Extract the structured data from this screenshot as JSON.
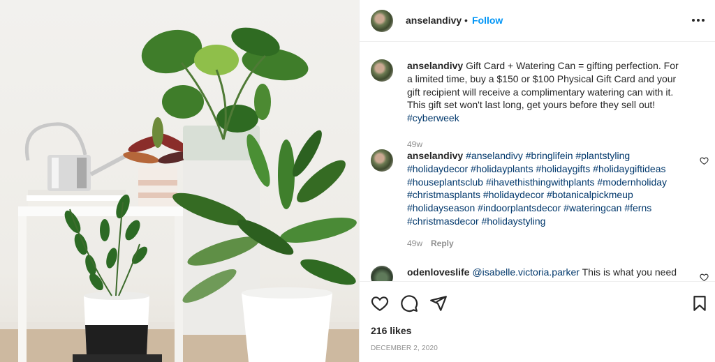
{
  "post": {
    "username": "anselandivy",
    "follow_label": "Follow",
    "separator": "•",
    "more_icon": "more-horizontal-icon"
  },
  "comments": [
    {
      "username": "anselandivy",
      "text": "Gift Card + Watering Can = gifting perfection. For a limited time, buy a $150 or $100 Physical Gift Card and your gift recipient will receive a complimentary watering can with it. This gift set won't last long, get yours before they sell out!",
      "hashtags": "#cyberweek",
      "age": "49w",
      "reply": ""
    },
    {
      "username": "anselandivy",
      "text": "",
      "hashtags": "#anselandivy #bringlifein #plantstyling #holidaydecor #holidayplants #holidaygifts #holidaygiftideas #houseplantsclub #ihavethisthingwithplants #modernholiday #christmasplants #holidaydecor #botanicalpickmeup #holidayseason #indoorplantsdecor #wateringcan #ferns #christmasdecor #holidaystyling",
      "age": "49w",
      "reply": "Reply"
    },
    {
      "username": "odenloveslife",
      "mention": "@isabelle.victoria.parker",
      "text": "This is what you need"
    }
  ],
  "footer": {
    "likes": "216 likes",
    "date": "December 2, 2020"
  },
  "colors": {
    "link": "#00376b",
    "follow": "#0095f6",
    "muted": "#8e8e8e",
    "text": "#262626"
  }
}
